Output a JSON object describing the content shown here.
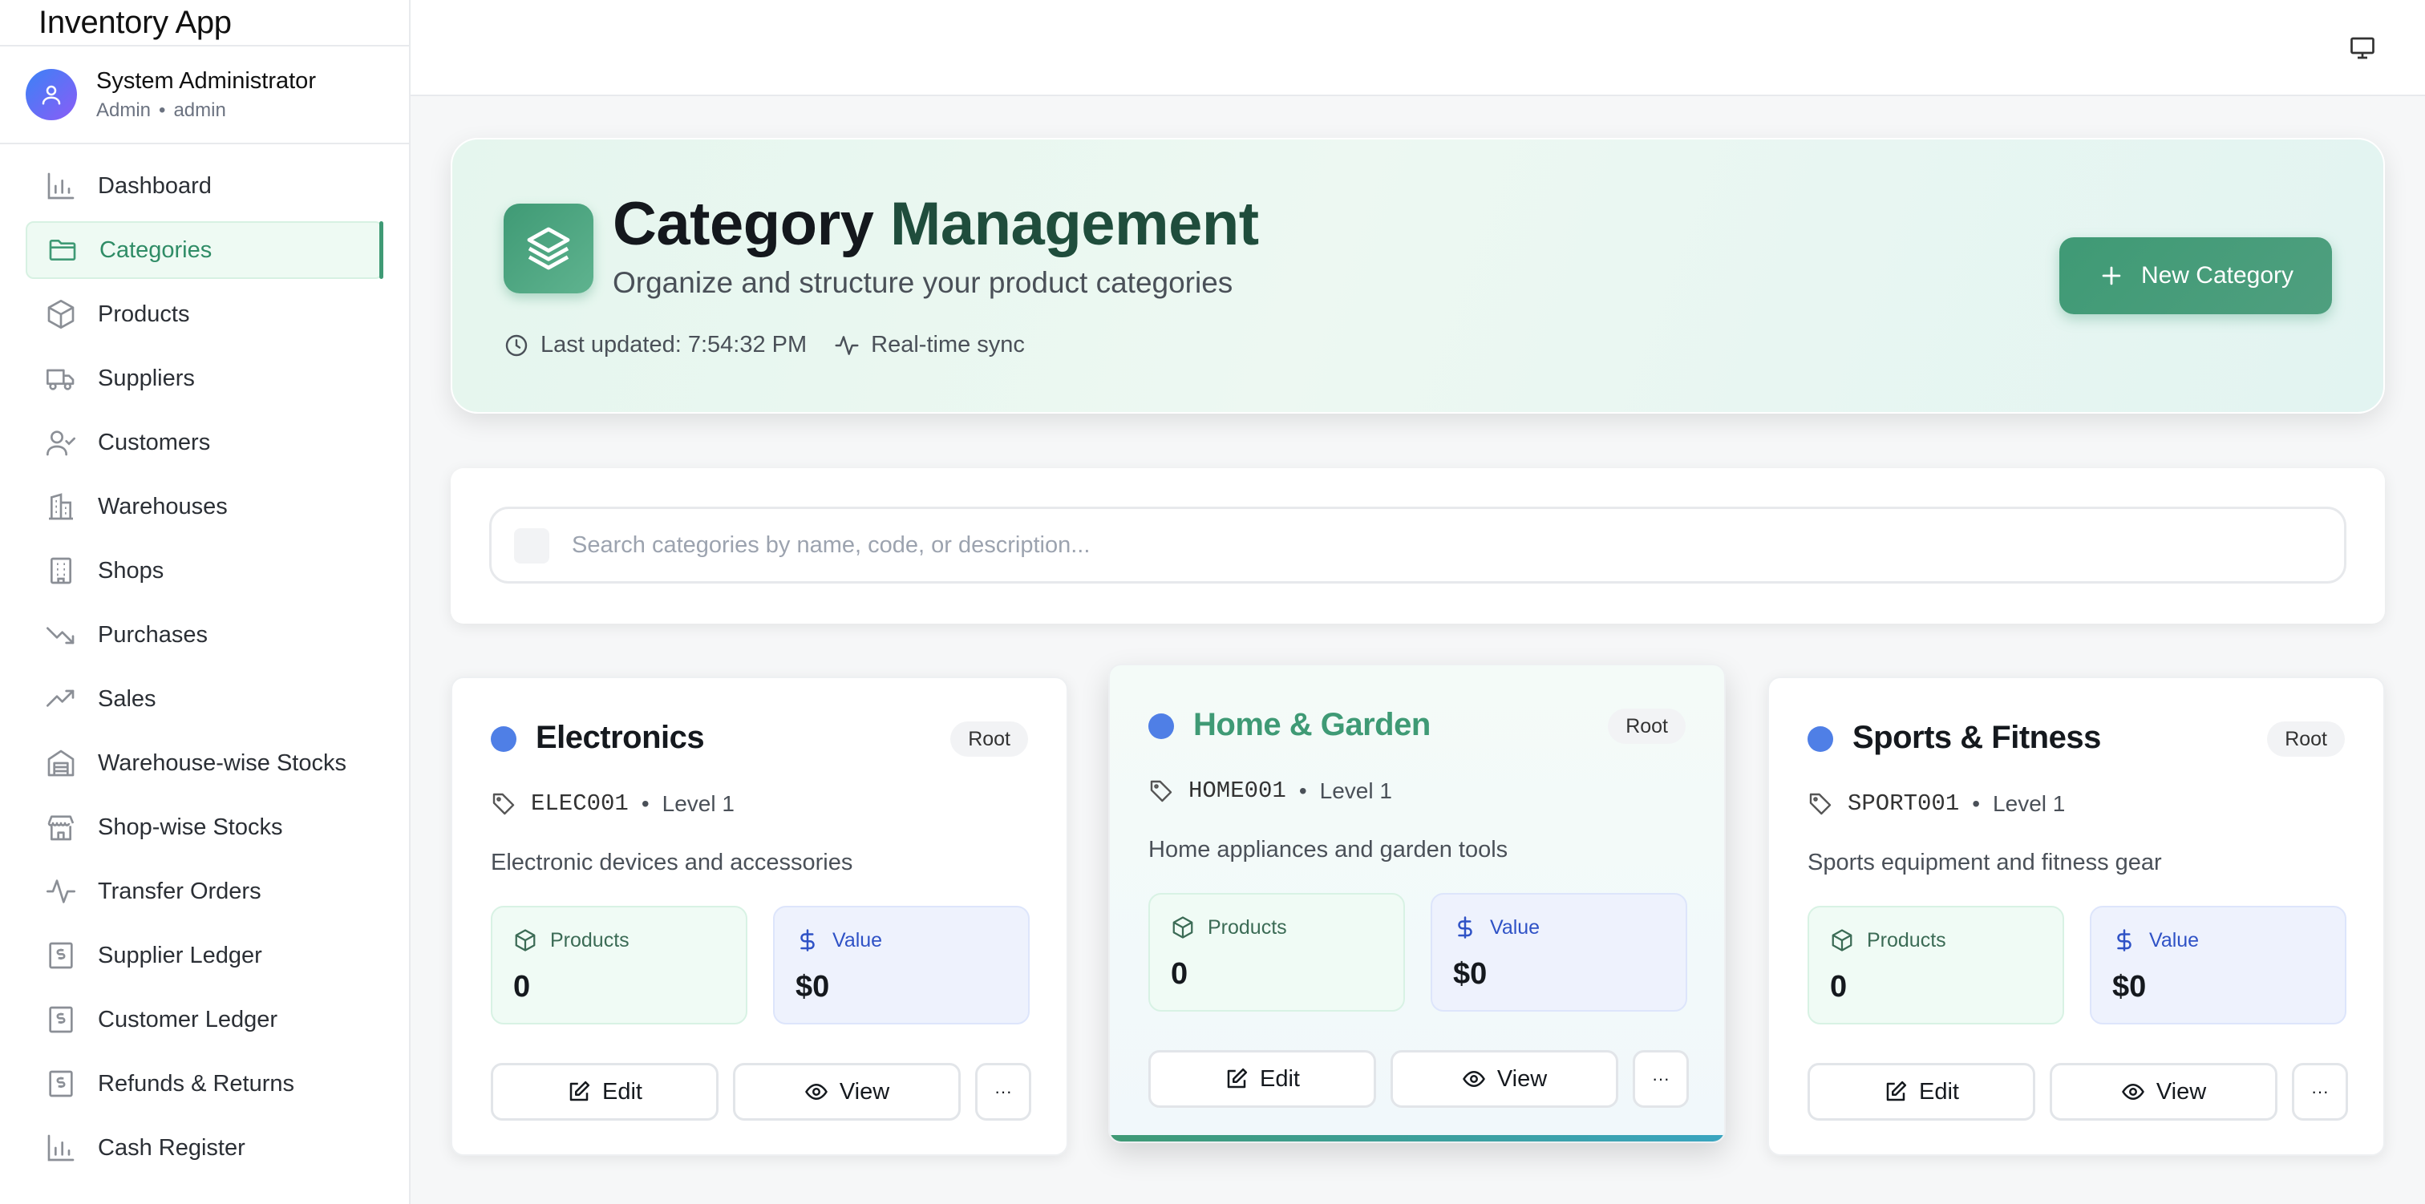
{
  "app": {
    "title": "Inventory App"
  },
  "user": {
    "name": "System Administrator",
    "role": "Admin",
    "username": "admin",
    "separator": "•"
  },
  "sidebar": {
    "items": [
      {
        "label": "Dashboard",
        "icon": "bar-chart-icon"
      },
      {
        "label": "Categories",
        "icon": "folder-icon",
        "active": true
      },
      {
        "label": "Products",
        "icon": "package-icon"
      },
      {
        "label": "Suppliers",
        "icon": "truck-icon"
      },
      {
        "label": "Customers",
        "icon": "user-check-icon"
      },
      {
        "label": "Warehouses",
        "icon": "building-icon"
      },
      {
        "label": "Shops",
        "icon": "store-building-icon"
      },
      {
        "label": "Purchases",
        "icon": "trending-down-icon"
      },
      {
        "label": "Sales",
        "icon": "trending-up-icon"
      },
      {
        "label": "Warehouse-wise Stocks",
        "icon": "warehouse-icon"
      },
      {
        "label": "Shop-wise Stocks",
        "icon": "store-icon"
      },
      {
        "label": "Transfer Orders",
        "icon": "activity-icon"
      },
      {
        "label": "Supplier Ledger",
        "icon": "receipt-icon"
      },
      {
        "label": "Customer Ledger",
        "icon": "receipt-icon"
      },
      {
        "label": "Refunds & Returns",
        "icon": "receipt-icon"
      },
      {
        "label": "Cash Register",
        "icon": "bar-chart-icon"
      }
    ]
  },
  "hero": {
    "title_part1": "Category",
    "title_part2": "Management",
    "subtitle": "Organize and structure your product categories",
    "last_updated": "Last updated: 7:54:32 PM",
    "sync": "Real-time sync",
    "new_button": "New Category"
  },
  "search": {
    "placeholder": "Search categories by name, code, or description..."
  },
  "categories": [
    {
      "name": "Electronics",
      "badge": "Root",
      "code": "ELEC001",
      "level": "Level 1",
      "description": "Electronic devices and accessories",
      "products_label": "Products",
      "products": "0",
      "value_label": "Value",
      "value": "$0",
      "edit": "Edit",
      "view": "View",
      "more": "···"
    },
    {
      "name": "Home & Garden",
      "badge": "Root",
      "code": "HOME001",
      "level": "Level 1",
      "description": "Home appliances and garden tools",
      "products_label": "Products",
      "products": "0",
      "value_label": "Value",
      "value": "$0",
      "edit": "Edit",
      "view": "View",
      "more": "···"
    },
    {
      "name": "Sports & Fitness",
      "badge": "Root",
      "code": "SPORT001",
      "level": "Level 1",
      "description": "Sports equipment and fitness gear",
      "products_label": "Products",
      "products": "0",
      "value_label": "Value",
      "value": "$0",
      "edit": "Edit",
      "view": "View",
      "more": "···"
    }
  ],
  "colors": {
    "accent": "#3f9a75",
    "dot": "#4f7fe6",
    "value_blue": "#2f52c6"
  }
}
